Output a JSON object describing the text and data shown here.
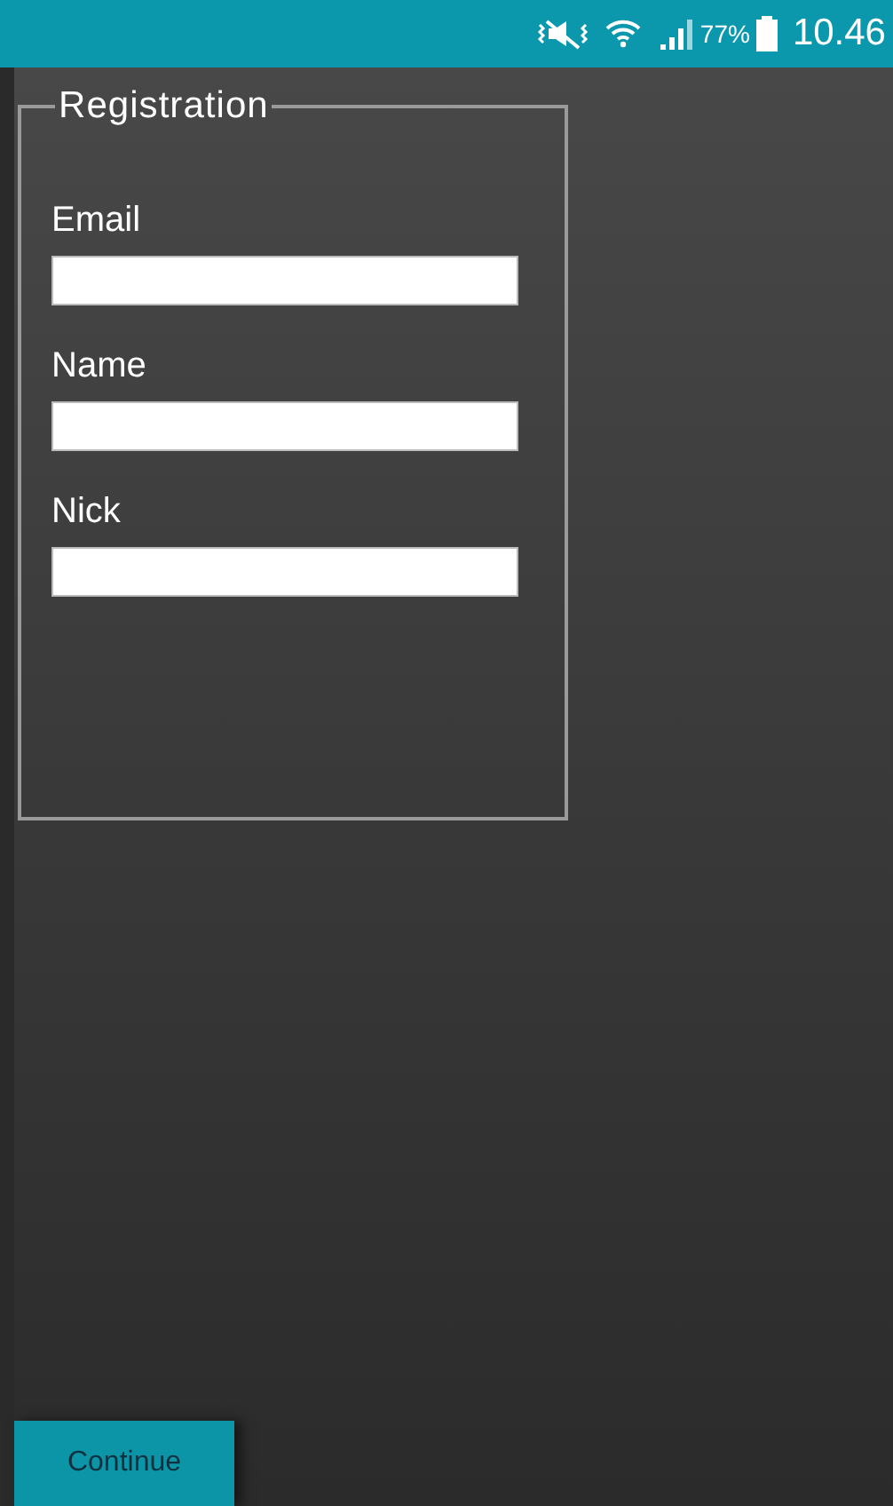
{
  "status_bar": {
    "battery_percent": "77%",
    "time": "10.46"
  },
  "form": {
    "title": "Registration",
    "fields": [
      {
        "label": "Email"
      },
      {
        "label": "Name"
      },
      {
        "label": "Nick"
      }
    ]
  },
  "continue_button": {
    "label": "Continue"
  }
}
